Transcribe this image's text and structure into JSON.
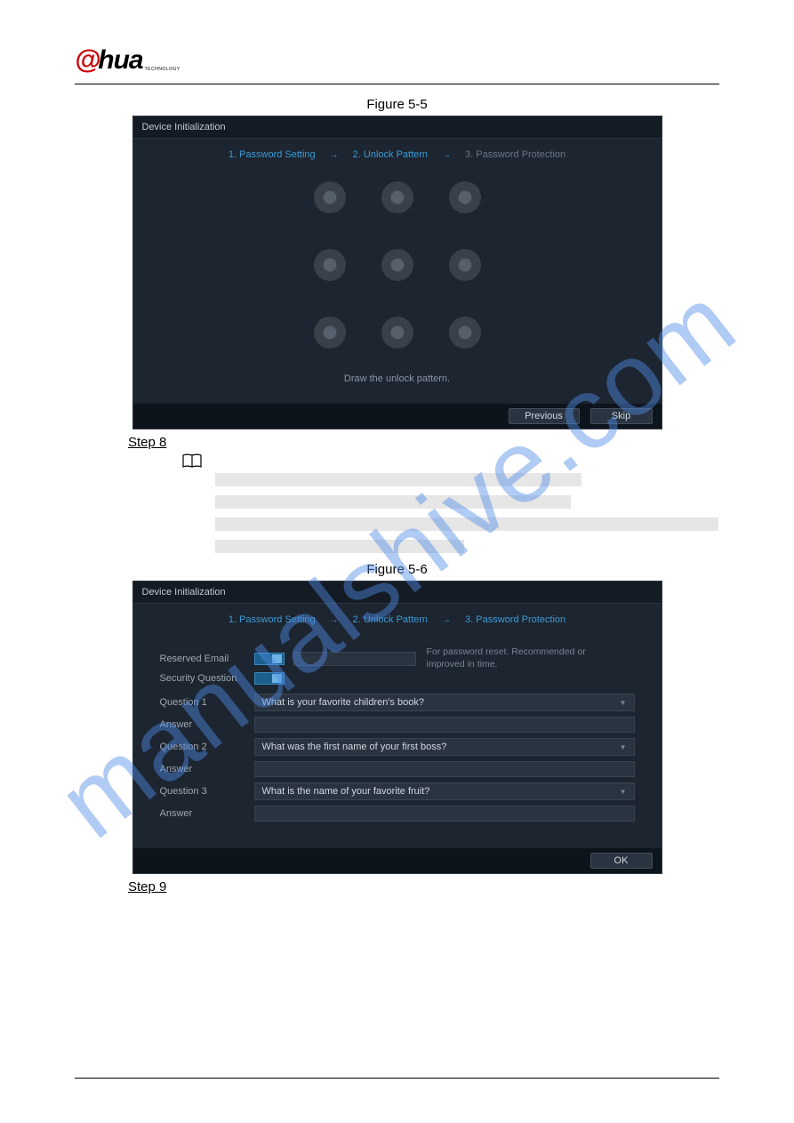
{
  "logo": {
    "at": "@",
    "hua": "hua",
    "tech": "TECHNOLOGY"
  },
  "watermark": "manualshive.com",
  "fig55": {
    "caption": "Figure 5-5",
    "title": "Device Initialization",
    "step1": "1.   Password Setting",
    "step2": "2.   Unlock Pattern",
    "step3": "3.   Password Protection",
    "arrow": "→",
    "draw": "Draw the unlock pattern.",
    "prev": "Previous",
    "skip": "Skip"
  },
  "step8": "Step 8",
  "fig56": {
    "caption": "Figure 5-6",
    "title": "Device Initialization",
    "step1": "1.   Password Setting",
    "step2": "2.   Unlock Pattern",
    "step3": "3.   Password Protection",
    "arrow": "→",
    "reservedEmail": "Reserved Email",
    "securityQuestion": "Security Question",
    "hint": "For password reset. Recommended or improved in time.",
    "q1label": "Question 1",
    "q1": "What is your favorite children's book?",
    "q2label": "Question 2",
    "q2": "What was the first name of your first boss?",
    "q3label": "Question 3",
    "q3": "What is the name of your favorite fruit?",
    "answer": "Answer",
    "ok": "OK"
  },
  "step9": "Step 9"
}
